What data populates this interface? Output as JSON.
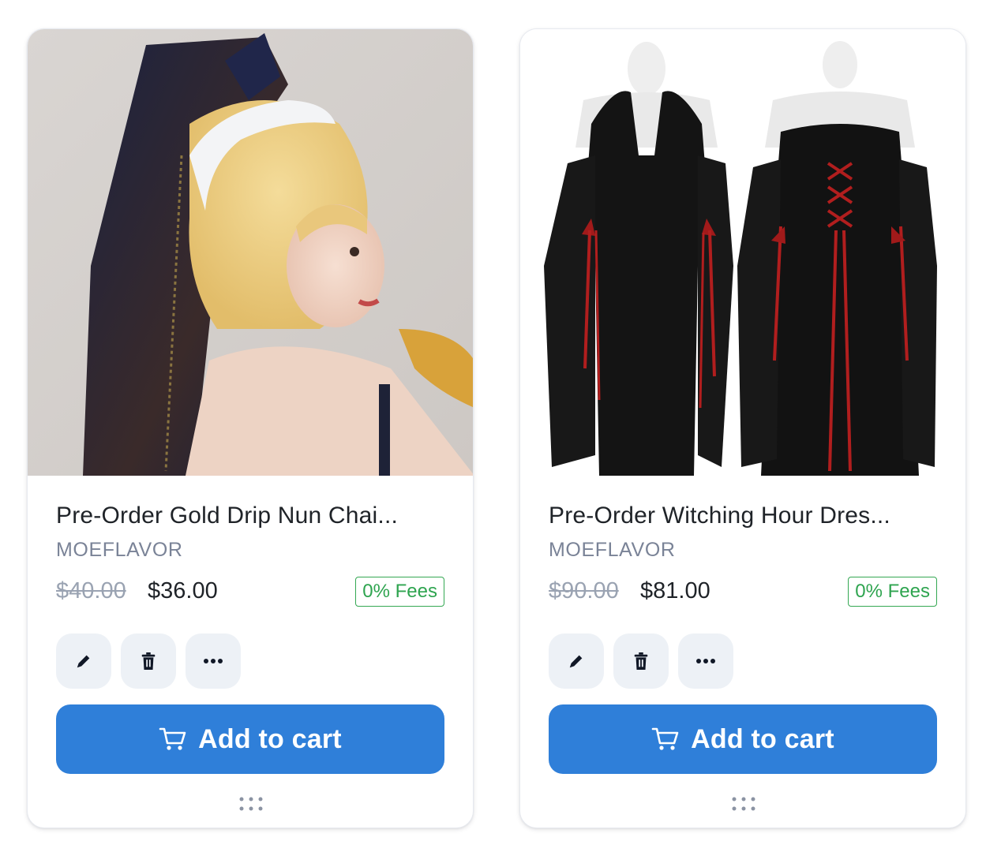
{
  "products": [
    {
      "title": "Pre-Order Gold Drip Nun Chai...",
      "brand": "MOEFLAVOR",
      "original_price": "$40.00",
      "price": "$36.00",
      "fees_badge": "0% Fees",
      "cart_label": "Add to cart"
    },
    {
      "title": "Pre-Order Witching Hour Dres...",
      "brand": "MOEFLAVOR",
      "original_price": "$90.00",
      "price": "$81.00",
      "fees_badge": "0% Fees",
      "cart_label": "Add to cart"
    }
  ],
  "icons": {
    "edit": "pencil-icon",
    "delete": "trash-icon",
    "more": "more-horizontal-icon",
    "cart": "cart-icon",
    "drag": "drag-handle-icon"
  },
  "colors": {
    "accent": "#2f7fd9",
    "fees_green": "#2ea44f",
    "icon_button_bg": "#edf1f6",
    "muted_text": "#7a8397"
  }
}
